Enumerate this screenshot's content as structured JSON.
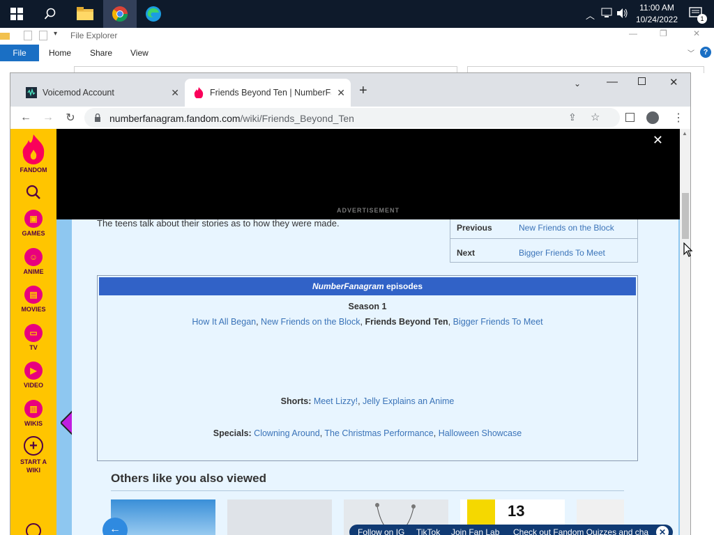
{
  "taskbar": {
    "time": "11:00 AM",
    "date": "10/24/2022",
    "notification_count": "1"
  },
  "file_explorer": {
    "title": "File Explorer",
    "ribbon_tabs": [
      "File",
      "Home",
      "Share",
      "View"
    ]
  },
  "browser": {
    "tabs": [
      {
        "title": "Voicemod Account"
      },
      {
        "title": "Friends Beyond Ten | NumberFanagram"
      }
    ],
    "url_host": "numberfanagram.fandom.com",
    "url_path": "/wiki/Friends_Beyond_Ten"
  },
  "fandom_rail": {
    "logo": "FANDOM",
    "items": [
      "GAMES",
      "ANIME",
      "MOVIES",
      "TV",
      "VIDEO",
      "WIKIS",
      "START A WIKI"
    ]
  },
  "ad": {
    "label": "ADVERTISEMENT"
  },
  "article": {
    "description": "The teens talk about their stories as to how they were made.",
    "nav": {
      "previous_label": "Previous",
      "previous_value": "New Friends on the Block",
      "next_label": "Next",
      "next_value": "Bigger Friends To Meet"
    },
    "navbox": {
      "title_italic": "NumberFanagram",
      "title_rest": " episodes",
      "season_label": "Season 1",
      "season_episodes": [
        "How It All Began",
        "New Friends on the Block",
        "Friends Beyond Ten",
        "Bigger Friends To Meet"
      ],
      "shorts_label": "Shorts:",
      "shorts": [
        "Meet Lizzy!",
        "Jelly Explains an Anime"
      ],
      "specials_label": "Specials:",
      "specials": [
        "Clowning Around",
        "The Christmas Performance",
        "Halloween Showcase"
      ]
    },
    "others_title": "Others like you also viewed",
    "thumb_text": "13",
    "social": [
      "Follow on IG",
      "TikTok",
      "Join Fan Lab",
      "Check out Fandom Quizzes and cha"
    ]
  }
}
